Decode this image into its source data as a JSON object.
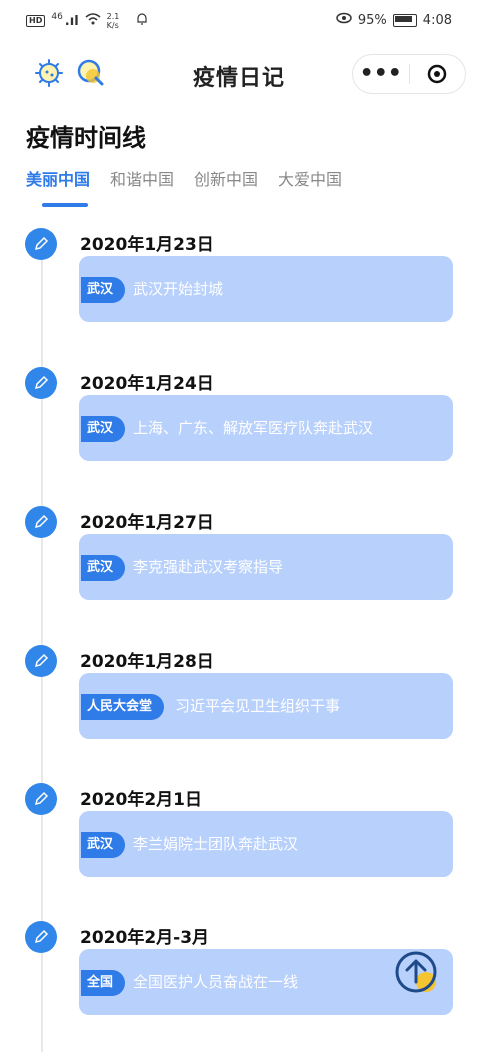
{
  "status_bar": {
    "left_badges": [
      "HD",
      "46",
      ".ıl"
    ],
    "net_speed": "2.1 K/s",
    "battery": "95%",
    "time": "4:08"
  },
  "nav": {
    "title": "疫情日记",
    "capsule_more": "•••"
  },
  "page_title": "疫情时间线",
  "tabs": [
    {
      "label": "美丽中国",
      "active": true
    },
    {
      "label": "和谐中国",
      "active": false
    },
    {
      "label": "创新中国",
      "active": false
    },
    {
      "label": "大爱中国",
      "active": false
    }
  ],
  "timeline": [
    {
      "date": "2020年1月23日",
      "tag": "武汉",
      "event": "武汉开始封城"
    },
    {
      "date": "2020年1月24日",
      "tag": "武汉",
      "event": "上海、广东、解放军医疗队奔赴武汉"
    },
    {
      "date": "2020年1月27日",
      "tag": "武汉",
      "event": "李克强赴武汉考察指导"
    },
    {
      "date": "2020年1月28日",
      "tag": "人民大会堂",
      "event": "习近平会见卫生组织干事"
    },
    {
      "date": "2020年2月1日",
      "tag": "武汉",
      "event": "李兰娟院士团队奔赴武汉"
    },
    {
      "date": "2020年2月-3月",
      "tag": "全国",
      "event": "全国医护人员奋战在一线"
    }
  ],
  "colors": {
    "accent": "#2f7be8",
    "card": "#b8d0fc",
    "dot": "#3186ea"
  }
}
